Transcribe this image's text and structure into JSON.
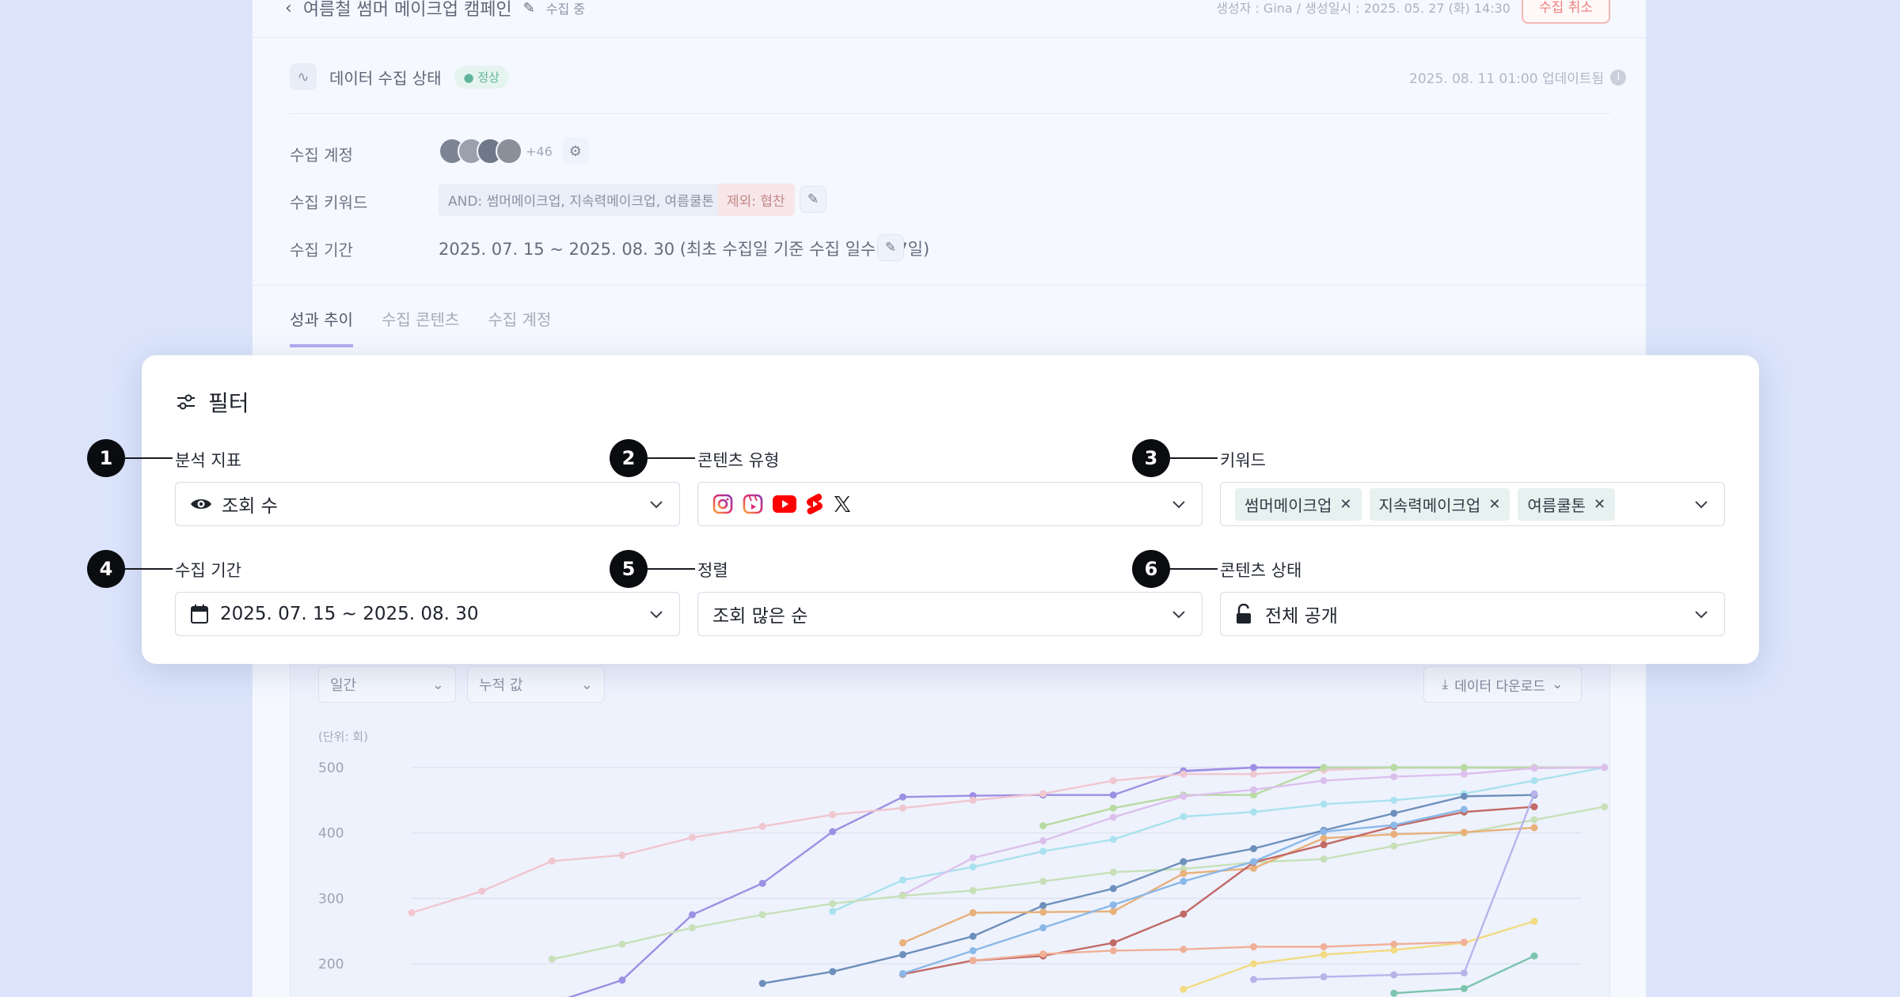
{
  "header": {
    "title": "여름철 썸머 메이크업 캠페인",
    "status": "수집 중",
    "meta": "생성자 : Gina / 생성일시 : 2025. 05. 27 (화) 14:30",
    "cancel_label": "수집 취소"
  },
  "collection_status": {
    "label": "데이터 수집 상태",
    "badge": "정상",
    "updated": "2025. 08. 11 01:00 업데이트됨"
  },
  "details": {
    "accounts_label": "수집 계정",
    "accounts_more": "+46",
    "keywords_label": "수집 키워드",
    "keywords_and": "AND: 썸머메이크업, 지속력메이크업, 여름쿨톤",
    "keywords_exclude": "제외: 협찬",
    "period_label": "수집 기간",
    "period_value": "2025. 07. 15 ~ 2025. 08. 30 (최초 수집일 기준 수집 일수: 47일)"
  },
  "tabs": [
    {
      "label": "성과 추이",
      "active": true
    },
    {
      "label": "수집 콘텐츠",
      "active": false
    },
    {
      "label": "수집 계정",
      "active": false
    }
  ],
  "chart_controls": {
    "interval": "일간",
    "value_mode": "누적 값",
    "download": "데이터 다운로드",
    "unit": "(단위: 회)"
  },
  "filter": {
    "title": "필터",
    "fields": [
      {
        "num": "1",
        "label": "분석 지표",
        "value": "조회 수",
        "icon": "eye-icon"
      },
      {
        "num": "2",
        "label": "콘텐츠 유형",
        "value": "",
        "icons": [
          "instagram-icon",
          "instagram-reels-icon",
          "youtube-icon",
          "youtube-shorts-icon",
          "x-icon"
        ]
      },
      {
        "num": "3",
        "label": "키워드",
        "tags": [
          "썸머메이크업",
          "지속력메이크업",
          "여름쿨톤"
        ]
      },
      {
        "num": "4",
        "label": "수집 기간",
        "value": "2025. 07. 15 ~ 2025. 08. 30",
        "icon": "calendar-icon"
      },
      {
        "num": "5",
        "label": "정렬",
        "value": "조회 많은 순"
      },
      {
        "num": "6",
        "label": "콘텐츠 상태",
        "value": "전체 공개",
        "icon": "unlock-icon"
      }
    ]
  },
  "colors": {
    "accent": "#b3aaf0",
    "status_ok": "#5fb59b",
    "cancel": "#ef7f7f"
  },
  "chart_data": {
    "type": "line",
    "ylabel": "(단위: 회)",
    "yticks": [
      500,
      400,
      300,
      200
    ],
    "ylim": [
      150,
      510
    ],
    "x": [
      0,
      1,
      2,
      3,
      4,
      5,
      6,
      7,
      8,
      9,
      10,
      11,
      12,
      13,
      14,
      15,
      16,
      17
    ],
    "series": [
      {
        "color": "#b9a7ef",
        "values": [
          null,
          null,
          null,
          null,
          null,
          null,
          null,
          null,
          null,
          null,
          null,
          494,
          500,
          500,
          500,
          500,
          500,
          500
        ]
      },
      {
        "color": "#9d8fe3",
        "values": [
          null,
          null,
          140,
          175,
          275,
          323,
          402,
          455,
          457,
          458,
          458,
          495,
          500,
          500,
          500,
          500,
          500,
          500
        ]
      },
      {
        "color": "#f0c6cf",
        "values": [
          278,
          311,
          357,
          366,
          393,
          410,
          428,
          438,
          450,
          460,
          480,
          490,
          490,
          496,
          500,
          500,
          500,
          500
        ]
      },
      {
        "color": "#b8dba2",
        "values": [
          null,
          null,
          null,
          null,
          null,
          null,
          null,
          null,
          null,
          411,
          438,
          458,
          458,
          500,
          500,
          500,
          500,
          500
        ]
      },
      {
        "color": "#a9e2ee",
        "values": [
          null,
          null,
          null,
          null,
          null,
          null,
          280,
          328,
          348,
          372,
          390,
          425,
          432,
          444,
          450,
          460,
          480,
          500
        ]
      },
      {
        "color": "#dcc0ec",
        "values": [
          null,
          null,
          null,
          null,
          null,
          null,
          null,
          305,
          362,
          388,
          424,
          456,
          466,
          480,
          486,
          490,
          499,
          500
        ]
      },
      {
        "color": "#c7e0b8",
        "values": [
          null,
          null,
          207,
          230,
          255,
          275,
          292,
          304,
          312,
          326,
          340,
          345,
          355,
          360,
          380,
          400,
          420,
          440
        ]
      },
      {
        "color": "#6d8fbb",
        "values": [
          null,
          null,
          null,
          null,
          null,
          170,
          188,
          214,
          242,
          289,
          315,
          356,
          376,
          404,
          430,
          456,
          458,
          null
        ]
      },
      {
        "color": "#e8b07a",
        "values": [
          null,
          null,
          null,
          null,
          null,
          null,
          null,
          232,
          278,
          279,
          280,
          338,
          346,
          392,
          398,
          401,
          408,
          null
        ]
      },
      {
        "color": "#c26a66",
        "values": [
          null,
          null,
          null,
          null,
          null,
          null,
          null,
          184,
          205,
          212,
          232,
          276,
          355,
          382,
          410,
          432,
          440,
          null
        ]
      },
      {
        "color": "#8ab8e8",
        "values": [
          null,
          null,
          null,
          null,
          null,
          null,
          null,
          185,
          220,
          255,
          290,
          326,
          356,
          402,
          412,
          436,
          null,
          null
        ]
      },
      {
        "color": "#f2db80",
        "values": [
          null,
          null,
          null,
          null,
          null,
          null,
          null,
          null,
          null,
          null,
          null,
          161,
          200,
          214,
          221,
          232,
          265,
          null
        ]
      },
      {
        "color": "#f0b098",
        "values": [
          null,
          null,
          null,
          null,
          null,
          null,
          null,
          null,
          205,
          215,
          220,
          222,
          226,
          226,
          230,
          233,
          null,
          null
        ]
      },
      {
        "color": "#b8b4ea",
        "values": [
          null,
          null,
          null,
          null,
          null,
          null,
          null,
          null,
          null,
          null,
          null,
          null,
          176,
          180,
          183,
          186,
          460,
          null
        ]
      },
      {
        "color": "#7cc4ae",
        "values": [
          null,
          null,
          null,
          null,
          null,
          null,
          null,
          null,
          null,
          null,
          null,
          null,
          null,
          null,
          155,
          162,
          212,
          null
        ]
      }
    ]
  }
}
